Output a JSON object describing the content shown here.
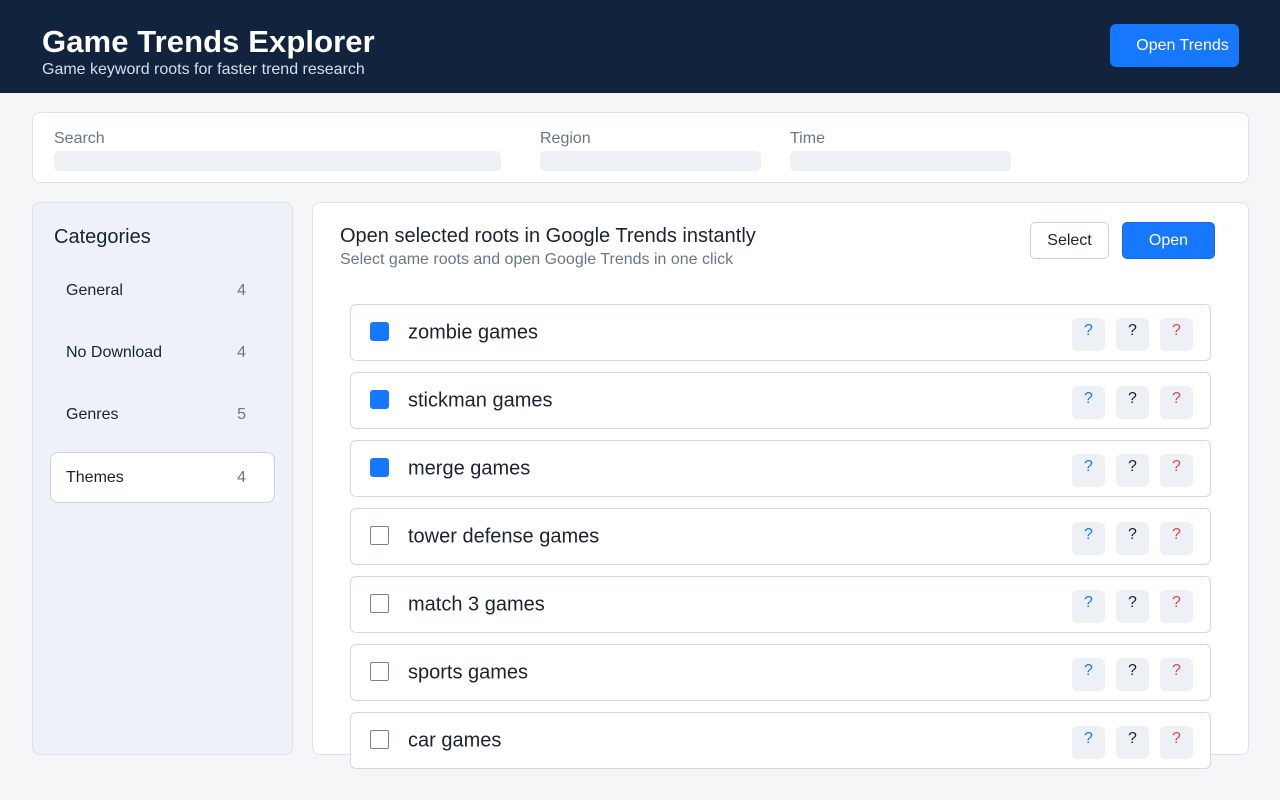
{
  "header": {
    "title": "Game Trends Explorer",
    "subtitle": "Game keyword roots for faster trend research",
    "open_trends_label": "Open Trends"
  },
  "filters": {
    "search_label": "Search",
    "search_value": "",
    "region_label": "Region",
    "region_value": "",
    "time_label": "Time",
    "time_value": ""
  },
  "sidebar": {
    "title": "Categories",
    "items": [
      {
        "label": "General",
        "count": "4",
        "active": false
      },
      {
        "label": "No Download",
        "count": "4",
        "active": false
      },
      {
        "label": "Genres",
        "count": "5",
        "active": false
      },
      {
        "label": "Themes",
        "count": "4",
        "active": true
      }
    ]
  },
  "main": {
    "title": "Open selected roots in Google Trends instantly",
    "subtitle": "Select game roots and open Google Trends in one click",
    "select_label": "Select",
    "open_label": "Open",
    "action_glyph": "?",
    "action_icons": [
      "blue-action-icon",
      "dark-action-icon",
      "red-action-icon"
    ],
    "roots": [
      {
        "label": "zombie games",
        "checked": true
      },
      {
        "label": "stickman games",
        "checked": true
      },
      {
        "label": "merge games",
        "checked": true
      },
      {
        "label": "tower defense games",
        "checked": false
      },
      {
        "label": "match 3 games",
        "checked": false
      },
      {
        "label": "sports games",
        "checked": false
      },
      {
        "label": "car games",
        "checked": false
      }
    ]
  },
  "colors": {
    "header_bg": "#12233d",
    "accent": "#1677ff",
    "danger": "#e04848"
  }
}
